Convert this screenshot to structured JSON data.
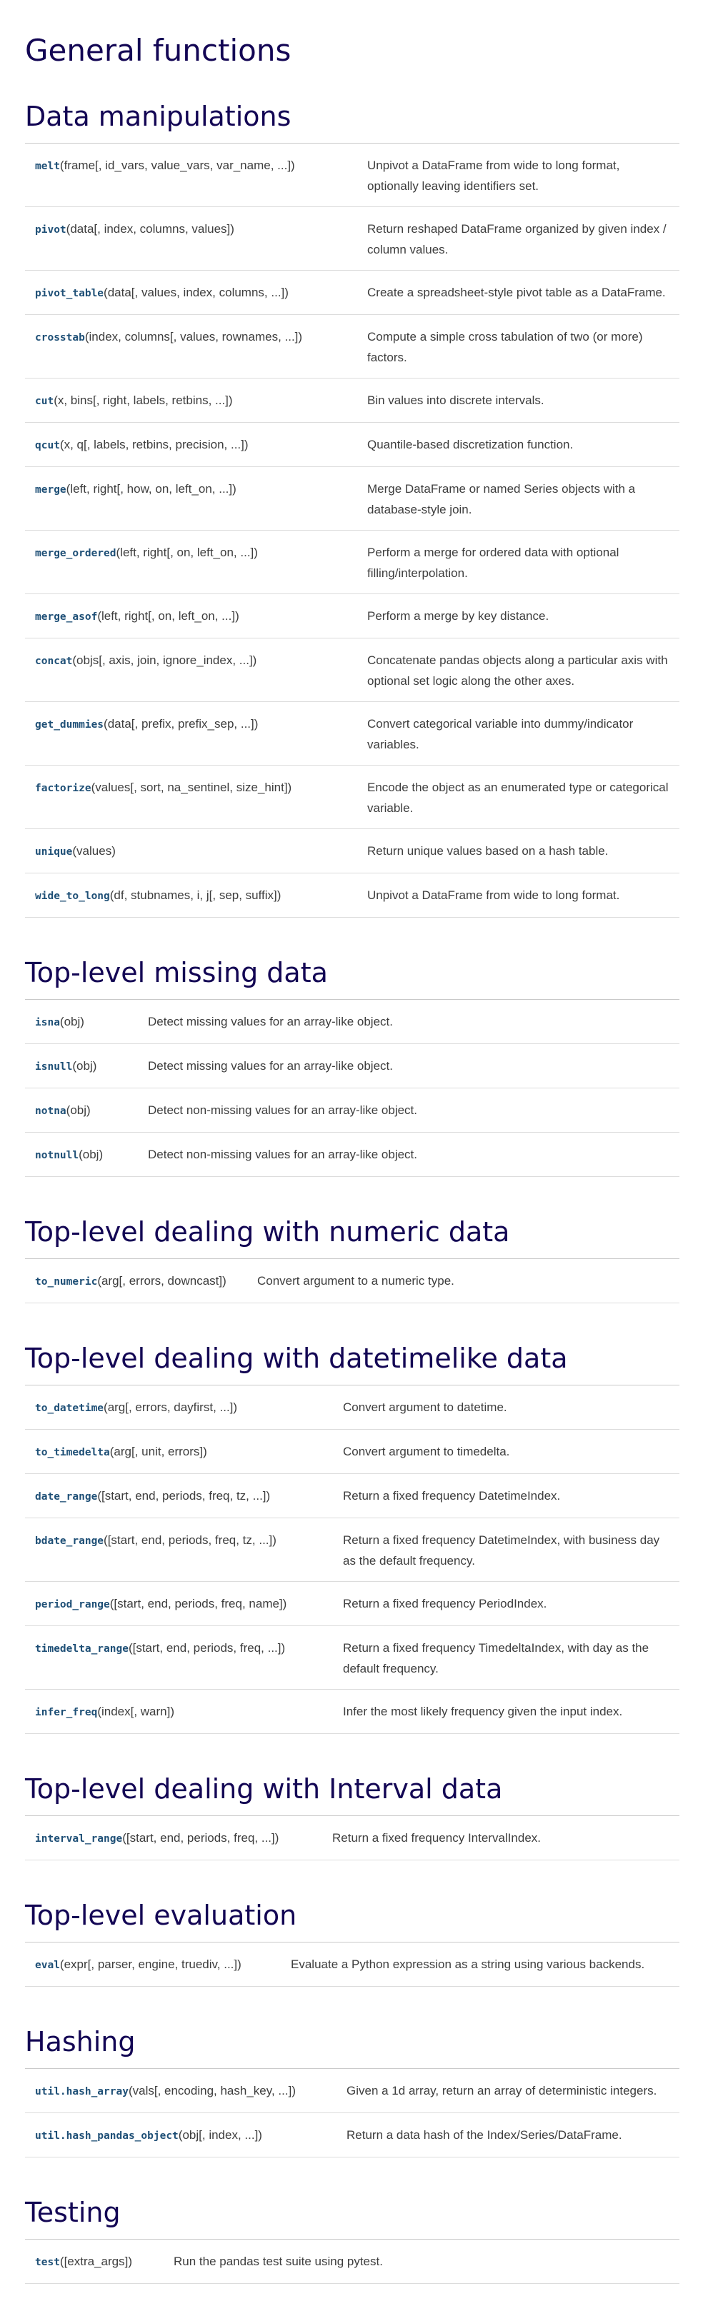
{
  "title": "General functions",
  "sections": [
    {
      "heading": "Data manipulations",
      "rows": [
        {
          "name": "melt",
          "args": "(frame[, id_vars, value_vars, var_name, ...])",
          "desc": "Unpivot a DataFrame from wide to long format, optionally leaving identifiers set."
        },
        {
          "name": "pivot",
          "args": "(data[, index, columns, values])",
          "desc": "Return reshaped DataFrame organized by given index / column values."
        },
        {
          "name": "pivot_table",
          "args": "(data[, values, index, columns, ...])",
          "desc": "Create a spreadsheet-style pivot table as a DataFrame."
        },
        {
          "name": "crosstab",
          "args": "(index, columns[, values, rownames, ...])",
          "desc": "Compute a simple cross tabulation of two (or more) factors."
        },
        {
          "name": "cut",
          "args": "(x, bins[, right, labels, retbins, ...])",
          "desc": "Bin values into discrete intervals."
        },
        {
          "name": "qcut",
          "args": "(x, q[, labels, retbins, precision, ...])",
          "desc": "Quantile-based discretization function."
        },
        {
          "name": "merge",
          "args": "(left, right[, how, on, left_on, ...])",
          "desc": "Merge DataFrame or named Series objects with a database-style join."
        },
        {
          "name": "merge_ordered",
          "args": "(left, right[, on, left_on, ...])",
          "desc": "Perform a merge for ordered data with optional filling/interpolation."
        },
        {
          "name": "merge_asof",
          "args": "(left, right[, on, left_on, ...])",
          "desc": "Perform a merge by key distance."
        },
        {
          "name": "concat",
          "args": "(objs[, axis, join, ignore_index, ...])",
          "desc": "Concatenate pandas objects along a particular axis with optional set logic along the other axes."
        },
        {
          "name": "get_dummies",
          "args": "(data[, prefix, prefix_sep, ...])",
          "desc": "Convert categorical variable into dummy/indicator variables."
        },
        {
          "name": "factorize",
          "args": "(values[, sort, na_sentinel, size_hint])",
          "desc": "Encode the object as an enumerated type or categorical variable."
        },
        {
          "name": "unique",
          "args": "(values)",
          "desc": "Return unique values based on a hash table."
        },
        {
          "name": "wide_to_long",
          "args": "(df, stubnames, i, j[, sep, suffix])",
          "desc": "Unpivot a DataFrame from wide to long format."
        }
      ]
    },
    {
      "heading": "Top-level missing data",
      "rows": [
        {
          "name": "isna",
          "args": "(obj)",
          "desc": "Detect missing values for an array-like object."
        },
        {
          "name": "isnull",
          "args": "(obj)",
          "desc": "Detect missing values for an array-like object."
        },
        {
          "name": "notna",
          "args": "(obj)",
          "desc": "Detect non-missing values for an array-like object."
        },
        {
          "name": "notnull",
          "args": "(obj)",
          "desc": "Detect non-missing values for an array-like object."
        }
      ]
    },
    {
      "heading": "Top-level dealing with numeric data",
      "rows": [
        {
          "name": "to_numeric",
          "args": "(arg[, errors, downcast])",
          "desc": "Convert argument to a numeric type."
        }
      ]
    },
    {
      "heading": "Top-level dealing with datetimelike data",
      "rows": [
        {
          "name": "to_datetime",
          "args": "(arg[, errors, dayfirst, ...])",
          "desc": "Convert argument to datetime."
        },
        {
          "name": "to_timedelta",
          "args": "(arg[, unit, errors])",
          "desc": "Convert argument to timedelta."
        },
        {
          "name": "date_range",
          "args": "([start, end, periods, freq, tz, ...])",
          "desc": "Return a fixed frequency DatetimeIndex."
        },
        {
          "name": "bdate_range",
          "args": "([start, end, periods, freq, tz, ...])",
          "desc": "Return a fixed frequency DatetimeIndex, with business day as the default frequency."
        },
        {
          "name": "period_range",
          "args": "([start, end, periods, freq, name])",
          "desc": "Return a fixed frequency PeriodIndex."
        },
        {
          "name": "timedelta_range",
          "args": "([start, end, periods, freq, ...])",
          "desc": "Return a fixed frequency TimedeltaIndex, with day as the default frequency."
        },
        {
          "name": "infer_freq",
          "args": "(index[, warn])",
          "desc": "Infer the most likely frequency given the input index."
        }
      ]
    },
    {
      "heading": "Top-level dealing with Interval data",
      "rows": [
        {
          "name": "interval_range",
          "args": "([start, end, periods, freq, ...])",
          "desc": "Return a fixed frequency IntervalIndex."
        }
      ]
    },
    {
      "heading": "Top-level evaluation",
      "rows": [
        {
          "name": "eval",
          "args": "(expr[, parser, engine, truediv, ...])",
          "desc": "Evaluate a Python expression as a string using various backends."
        }
      ]
    },
    {
      "heading": "Hashing",
      "rows": [
        {
          "name": "util.hash_array",
          "args": "(vals[, encoding, hash_key, ...])",
          "desc": "Given a 1d array, return an array of deterministic integers."
        },
        {
          "name": "util.hash_pandas_object",
          "args": "(obj[, index, ...])",
          "desc": "Return a data hash of the Index/Series/DataFrame."
        }
      ]
    },
    {
      "heading": "Testing",
      "rows": [
        {
          "name": "test",
          "args": "([extra_args])",
          "desc": "Run the pandas test suite using pytest."
        }
      ]
    }
  ]
}
